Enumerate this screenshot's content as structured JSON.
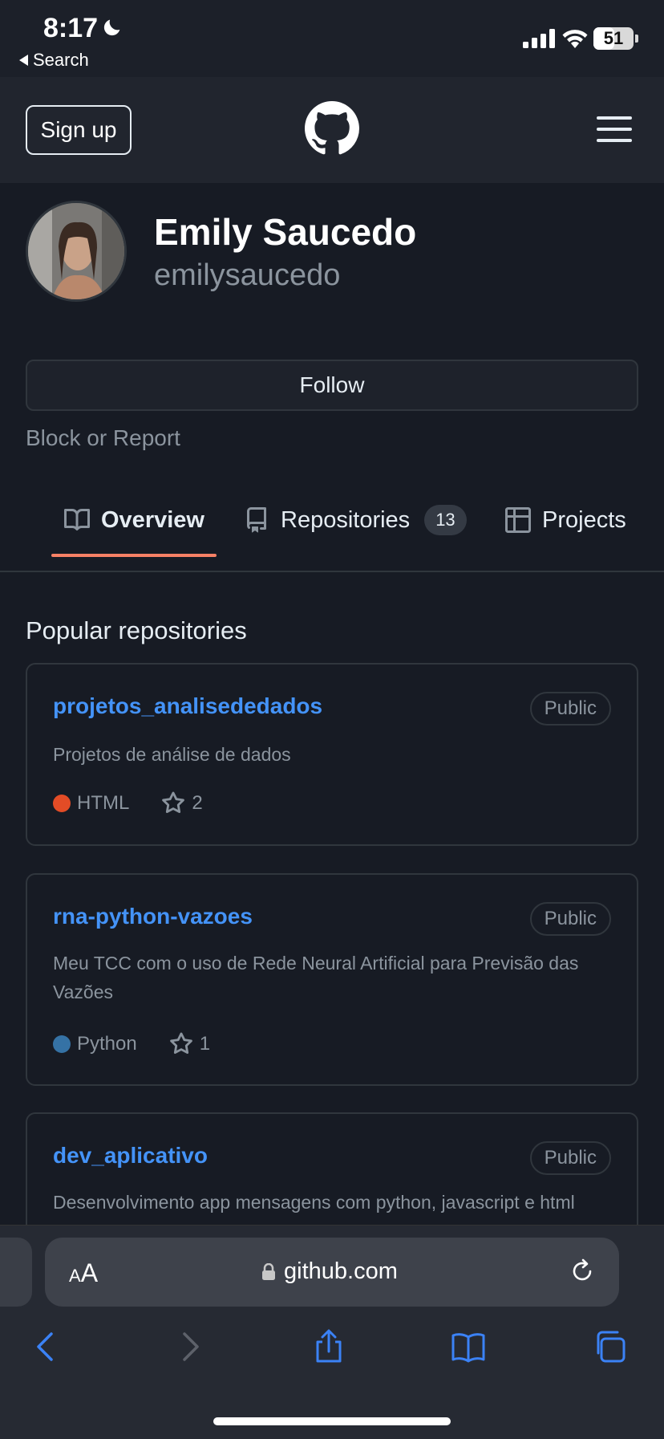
{
  "status_bar": {
    "time": "8:17",
    "back_label": "Search",
    "battery_level": "51",
    "battery_fraction": 0.51,
    "icons": [
      "moon-icon",
      "signal-icon",
      "wifi-icon",
      "battery-icon"
    ]
  },
  "header": {
    "signup_label": "Sign up",
    "logo": "github-logo-icon",
    "menu": "hamburger-icon"
  },
  "profile": {
    "display_name": "Emily Saucedo",
    "username": "emilysaucedo",
    "follow_label": "Follow",
    "block_report_label": "Block or Report"
  },
  "tabs": [
    {
      "label": "Overview",
      "icon": "book-icon",
      "selected": true
    },
    {
      "label": "Repositories",
      "icon": "repo-icon",
      "count": "13"
    },
    {
      "label": "Projects",
      "icon": "table-icon"
    }
  ],
  "popular_section": {
    "title": "Popular repositories",
    "repos": [
      {
        "name": "projetos_analisededados",
        "visibility": "Public",
        "description": "Projetos de análise de dados",
        "language": "HTML",
        "language_color": "#e34c26",
        "stars": "2"
      },
      {
        "name": "rna-python-vazoes",
        "visibility": "Public",
        "description": "Meu TCC com o uso de Rede Neural Artificial para Previsão das Vazões",
        "language": "Python",
        "language_color": "#3572A5",
        "stars": "1"
      },
      {
        "name": "dev_aplicativo",
        "visibility": "Public",
        "description": "Desenvolvimento app mensagens com python, javascript e html"
      }
    ]
  },
  "safari": {
    "text_size_label_small": "A",
    "text_size_label_large": "A",
    "url": "github.com",
    "icons": [
      "back-icon",
      "forward-icon",
      "share-icon",
      "bookmarks-icon",
      "tabs-icon",
      "reload-icon",
      "lock-icon"
    ]
  },
  "colors": {
    "background": "#171b24",
    "link": "#4493f8",
    "accent_underline": "#f78166",
    "safari_tint": "#3b82f6"
  }
}
